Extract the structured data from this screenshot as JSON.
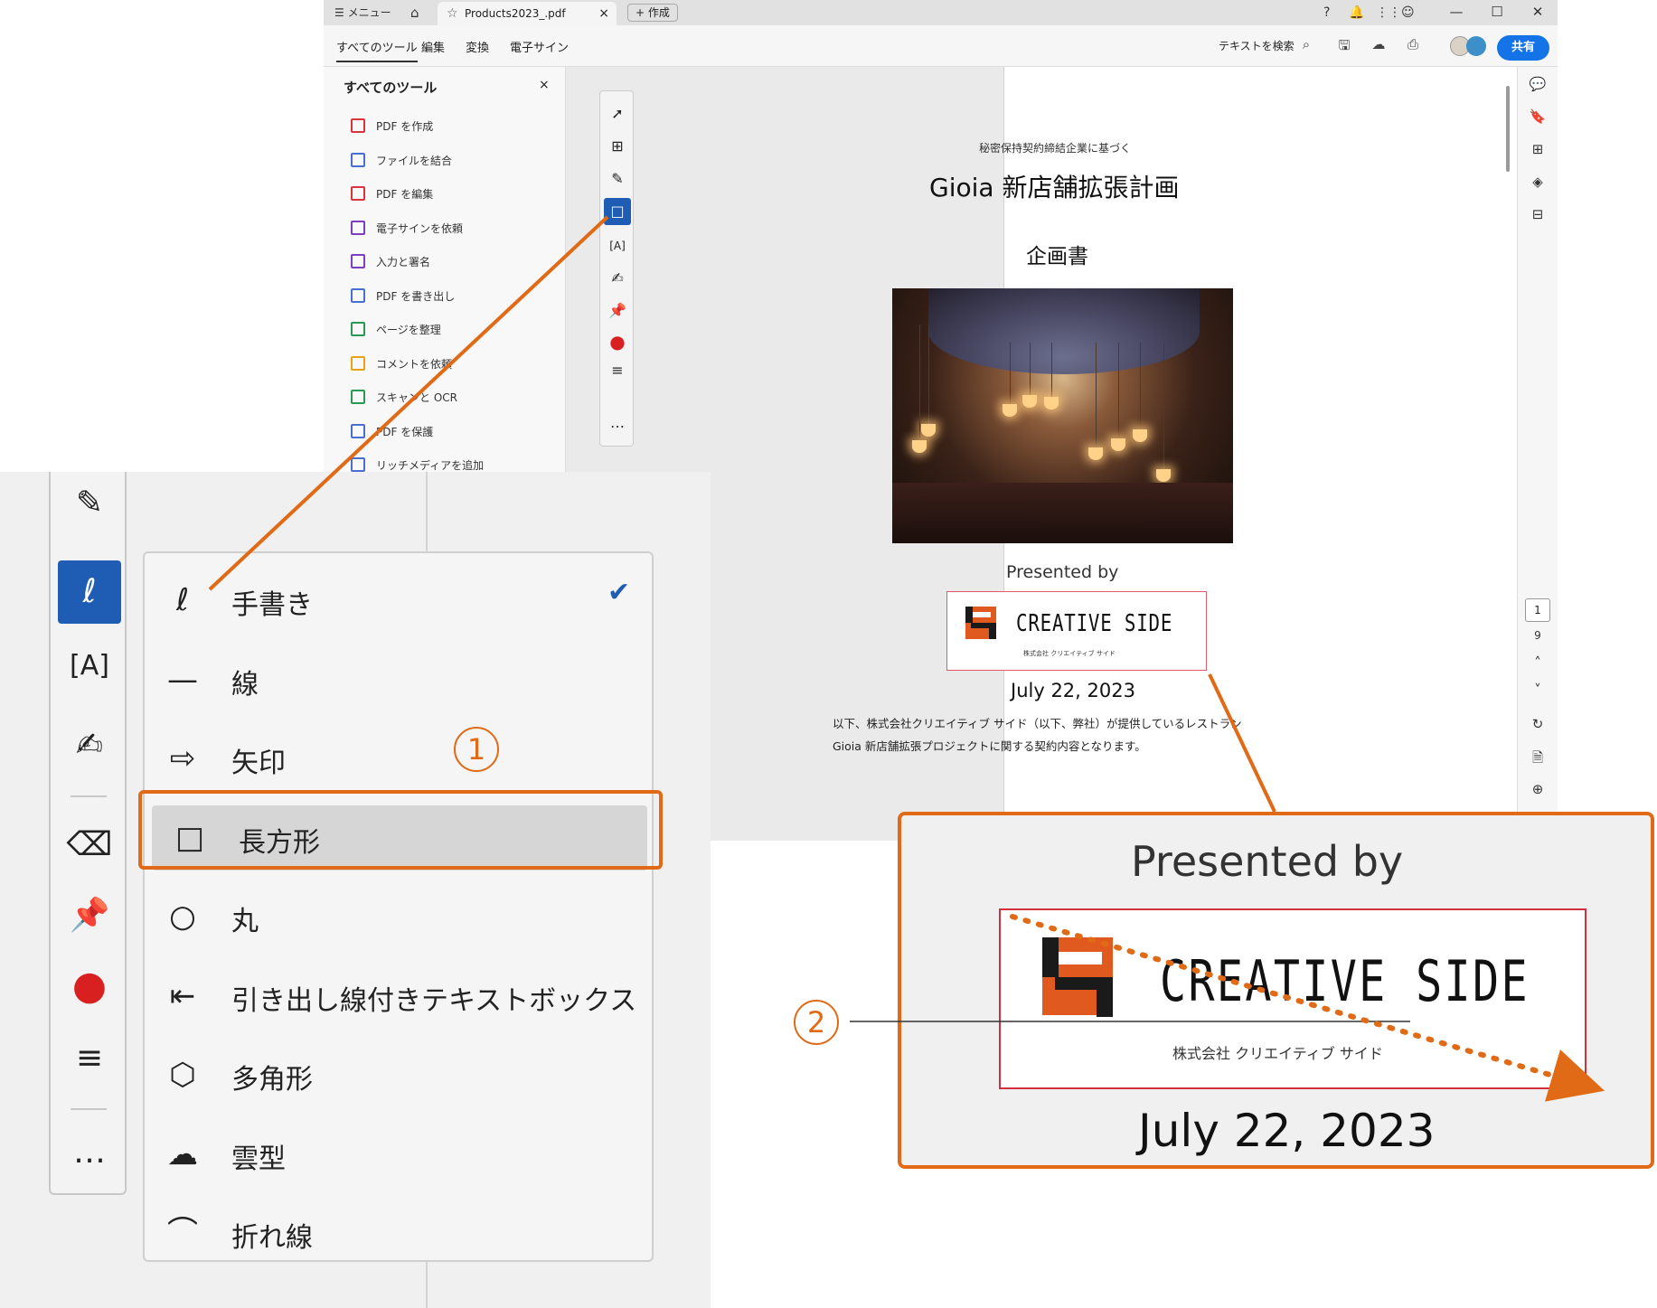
{
  "window": {
    "menu_label": "メニュー",
    "tab_title": "Products2023_.pdf",
    "new_button": "+ 作成",
    "close_tab": "×",
    "controls": [
      "—",
      "☐",
      "✕"
    ]
  },
  "menubar": {
    "items": [
      "すべてのツール",
      "編集",
      "変換",
      "電子サイン"
    ],
    "search_text": "テキストを検索",
    "share": "共有"
  },
  "leftpanel": {
    "title": "すべてのツール",
    "close": "×",
    "items": [
      {
        "label": "PDF を作成",
        "color": "#d9343f"
      },
      {
        "label": "ファイルを結合",
        "color": "#4a6fd1"
      },
      {
        "label": "PDF を編集",
        "color": "#d9343f"
      },
      {
        "label": "電子サインを依頼",
        "color": "#7b3fbf"
      },
      {
        "label": "入力と署名",
        "color": "#7b3fbf"
      },
      {
        "label": "PDF を書き出し",
        "color": "#4a6fd1"
      },
      {
        "label": "ページを整理",
        "color": "#2a9a52"
      },
      {
        "label": "コメントを依頼",
        "color": "#e6a317"
      },
      {
        "label": "スキャンと OCR",
        "color": "#2a9a52"
      },
      {
        "label": "PDF を保護",
        "color": "#4a6fd1"
      },
      {
        "label": "リッチメディアを追加",
        "color": "#4a6fd1"
      }
    ]
  },
  "document": {
    "subtitle": "秘密保持契約締結企業に基づく",
    "title": "Gioia 新店舗拡張計画",
    "doctype": "企画書",
    "presented_by": "Presented by",
    "logo_text": "CREATIVE SIDE",
    "logo_sub": "株式会社 クリエイティブ サイド",
    "date": "July 22, 2023",
    "body_line1": "以下、株式会社クリエイティブ サイド（以下、弊社）が提供しているレストラン",
    "body_line2": "Gioia 新店舗拡張プロジェクトに関する契約内容となります。",
    "page_current": "1",
    "page_total": "9"
  },
  "dropdown": {
    "items": [
      {
        "icon": "freehand-icon",
        "label": "手書き",
        "checked": true
      },
      {
        "icon": "line-icon",
        "label": "線"
      },
      {
        "icon": "arrow-icon",
        "label": "矢印"
      },
      {
        "icon": "rectangle-icon",
        "label": "長方形",
        "highlighted": true
      },
      {
        "icon": "circle-icon",
        "label": "丸"
      },
      {
        "icon": "callout-textbox-icon",
        "label": "引き出し線付きテキストボックス"
      },
      {
        "icon": "polygon-icon",
        "label": "多角形"
      },
      {
        "icon": "cloud-icon",
        "label": "雲型"
      },
      {
        "icon": "polyline-icon",
        "label": "折れ線"
      }
    ]
  },
  "annotations": {
    "step1": "1",
    "step2": "2",
    "accent": "#e06a15"
  }
}
